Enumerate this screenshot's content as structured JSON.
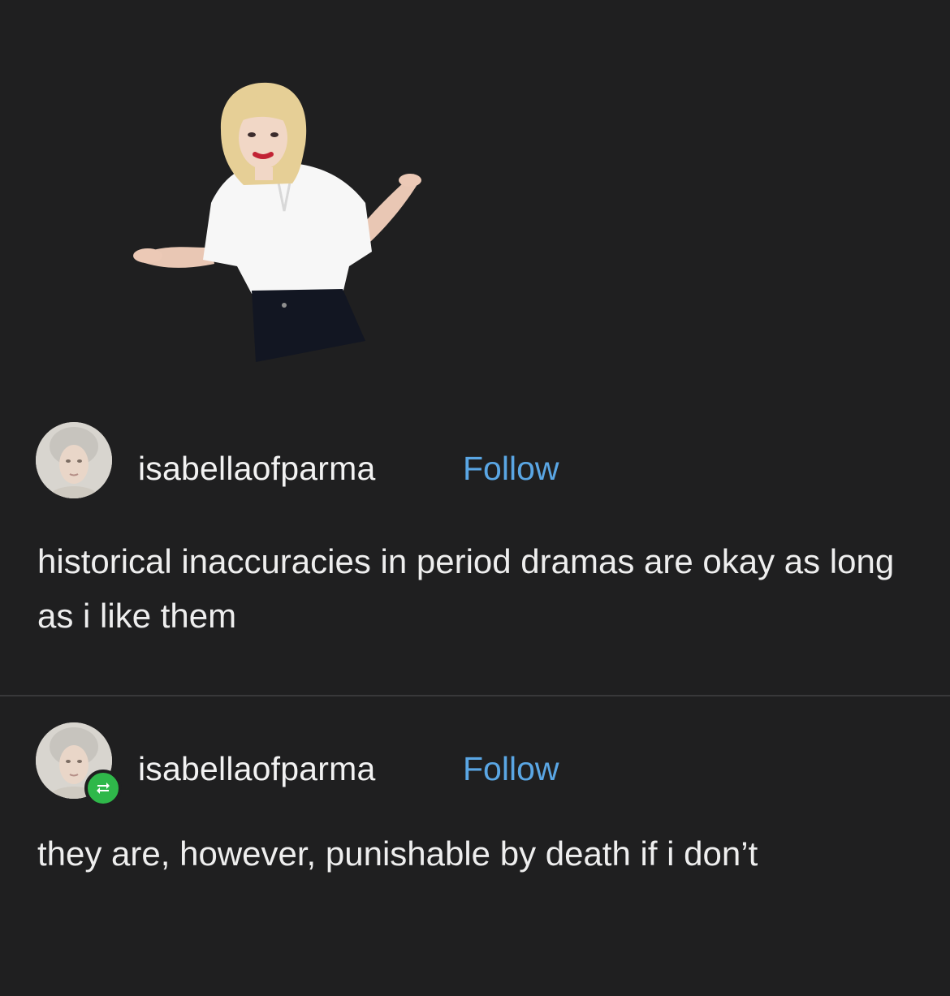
{
  "colors": {
    "background": "#1f1f20",
    "text": "#eeeeee",
    "follow_link": "#5aa6e4",
    "reblog_badge": "#2fb84a"
  },
  "sticker": {
    "icon": "shrugging-woman-sticker"
  },
  "posts": [
    {
      "username": "isabellaofparma",
      "follow_label": "Follow",
      "text": "historical inaccuracies in period dramas are okay as long as i like them",
      "reblogged": false
    },
    {
      "username": "isabellaofparma",
      "follow_label": "Follow",
      "text": "they are, however, punishable by death if i don’t",
      "reblogged": true,
      "badge_icon": "reblog-icon"
    }
  ]
}
